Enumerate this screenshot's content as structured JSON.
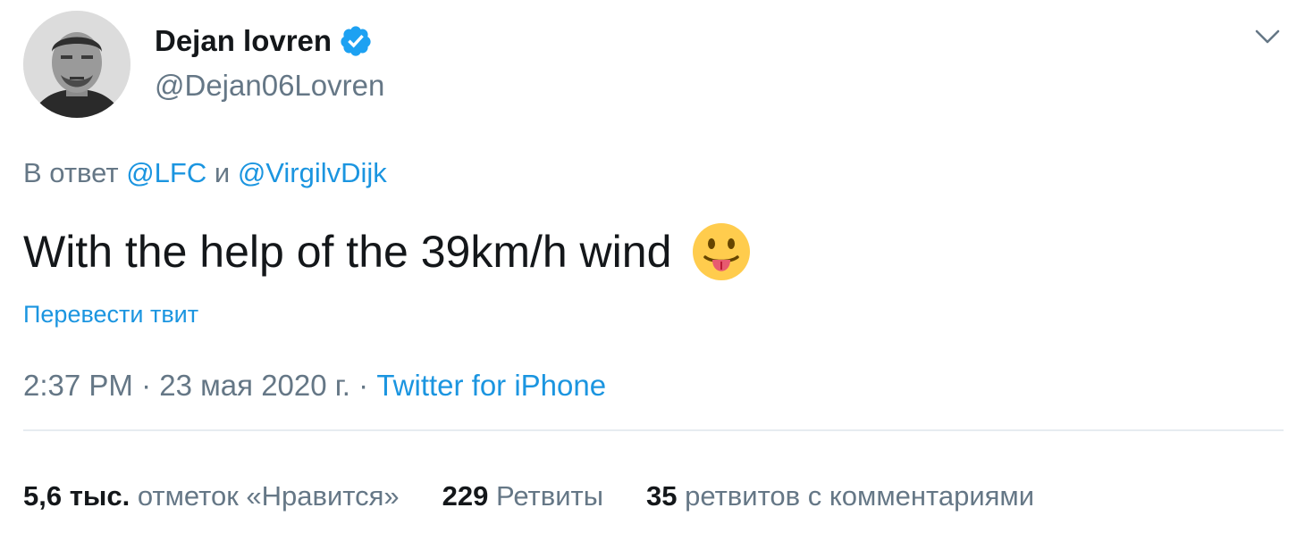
{
  "author": {
    "display_name": "Dejan lovren",
    "handle": "@Dejan06Lovren",
    "verified_icon": "verified-badge-icon"
  },
  "reply": {
    "prefix": "В ответ",
    "mention_1": "@LFC",
    "conjunction": "и",
    "mention_2": "@VirgilvDijk"
  },
  "tweet": {
    "text": "With the help of the 39km/h wind",
    "emoji": "face-with-tongue-icon"
  },
  "translate_label": "Перевести твит",
  "meta": {
    "time": "2:37 PM",
    "separator": "·",
    "date": "23 мая 2020 г.",
    "source": "Twitter for iPhone"
  },
  "stats": {
    "likes_count": "5,6 тыс.",
    "likes_label": "отметок «Нравится»",
    "retweets_count": "229",
    "retweets_label": "Ретвиты",
    "quotes_count": "35",
    "quotes_label": "ретвитов с комментариями"
  },
  "colors": {
    "link": "#1b95e0",
    "secondary_text": "#657786",
    "primary_text": "#14171a",
    "divider": "#e6ecf0"
  }
}
